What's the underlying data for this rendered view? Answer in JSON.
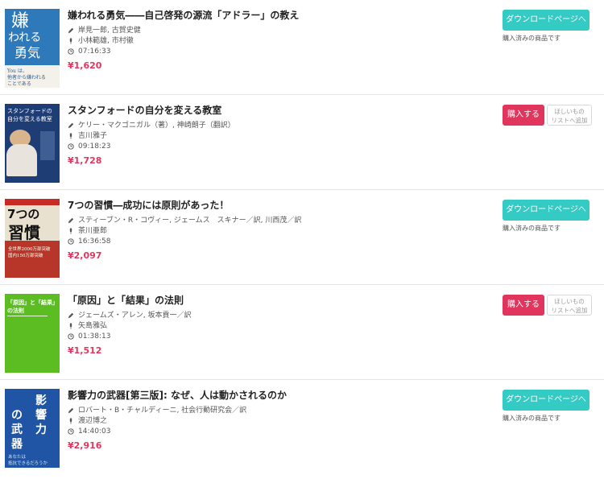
{
  "colors": {
    "accent_teal": "#33cbc4",
    "accent_pink": "#e0365e",
    "price": "#e0365e"
  },
  "icons": {
    "author": "pen-icon",
    "narrator": "mic-icon",
    "duration": "clock-icon"
  },
  "books": [
    {
      "title": "嫌われる勇気――自己啓発の源流「アドラー」の教え",
      "author": "岸見一郎, 古賀史健",
      "narrator": "小林範雄, 市村徹",
      "duration": "07:16:33",
      "price": "¥1,620",
      "status": "owned",
      "download_label": "ダウンロードページへ",
      "owned_label": "購入済みの商品です",
      "cover": {
        "line1": "嫌",
        "line2": "われる",
        "line3": "勇気",
        "small1": "You は、",
        "small2": "他者から嫌われる",
        "small3": "ことである"
      }
    },
    {
      "title": "スタンフォードの自分を変える教室",
      "author": "ケリー・マクゴニガル（著）, 神崎朗子（翻訳）",
      "narrator": "吉川雅子",
      "duration": "09:18:23",
      "price": "¥1,728",
      "status": "not_owned",
      "buy_label": "購入する",
      "wish_line1": "ほしいもの",
      "wish_line2": "リストへ追加",
      "cover": {
        "line1": "スタンフォードの",
        "line2": "自分を変える教室"
      }
    },
    {
      "title": "7つの習慣―成功には原則があった！",
      "author": "スティーブン・R・コヴィー, ジェームス　スキナー／訳, 川西茂／訳",
      "narrator": "茶川亜郎",
      "duration": "16:36:58",
      "price": "¥2,097",
      "status": "owned",
      "download_label": "ダウンロードページへ",
      "owned_label": "購入済みの商品です",
      "cover": {
        "line1": "7つの",
        "line2": "習慣",
        "small1": "全世界2000万部突破",
        "small2": "国内150万部突破"
      }
    },
    {
      "title": "「原因」と「結果」の法則",
      "author": "ジェームズ・アレン, 坂本貢一／訳",
      "narrator": "矢島雅弘",
      "duration": "01:38:13",
      "price": "¥1,512",
      "status": "not_owned",
      "buy_label": "購入する",
      "wish_line1": "ほしいもの",
      "wish_line2": "リストへ追加",
      "cover": {
        "line1": "「原因」と「結果」",
        "line2": "の法則"
      }
    },
    {
      "title": "影響力の武器[第三版]: なぜ、人は動かされるのか",
      "author": "ロバート・B・チャルディーニ, 社会行動研究会／訳",
      "narrator": "渡辺博之",
      "duration": "14:40:03",
      "price": "¥2,916",
      "status": "owned",
      "download_label": "ダウンロードページへ",
      "owned_label": "購入済みの商品です",
      "cover": {
        "line1": "影",
        "line2": "響",
        "line3": "力",
        "line4": "の",
        "line5": "武",
        "line6": "器",
        "small1": "あなたは",
        "small2": "抵抗できるだろうか"
      }
    }
  ]
}
